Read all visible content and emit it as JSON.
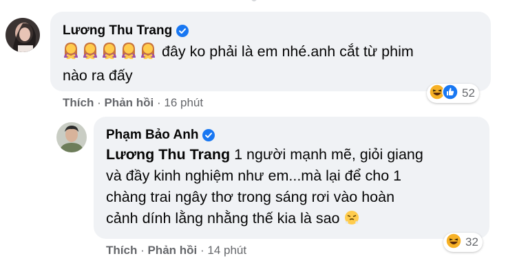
{
  "comment1": {
    "author": "Lương Thu Trang",
    "text_line1": "đây ko phải là em nhé.anh cắt từ phim",
    "text_line2": "nào ra đấy",
    "leading_emoji_icons": [
      "woman-gesturing-no-emoji",
      "woman-gesturing-no-emoji",
      "woman-gesturing-no-emoji",
      "woman-gesturing-no-emoji",
      "woman-gesturing-no-emoji"
    ],
    "like_label": "Thích",
    "reply_label": "Phản hồi",
    "time": "16 phút",
    "reaction_icons": [
      "haha-icon",
      "like-icon"
    ],
    "reaction_count": "52"
  },
  "comment2": {
    "author": "Phạm Bảo Anh",
    "mention": "Lương Thu Trang",
    "text_line1": "1 người mạnh mẽ, giỏi giang",
    "text_line2": "và đầy kinh nghiệm như em...mà lại để cho 1",
    "text_line3": "chàng trai ngây thơ trong sáng rơi vào hoàn",
    "text_line4": "cảnh dính lằng nhằng thế kia là sao",
    "trailing_emoji_icon": "face-with-steam-emoji",
    "like_label": "Thích",
    "reply_label": "Phản hồi",
    "time": "14 phút",
    "reaction_icons": [
      "haha-icon"
    ],
    "reaction_count": "32"
  },
  "colors": {
    "bubble": "#f0f2f5",
    "verified": "#1877f2",
    "meta_text": "#65676b",
    "haha": "#f7b125"
  }
}
